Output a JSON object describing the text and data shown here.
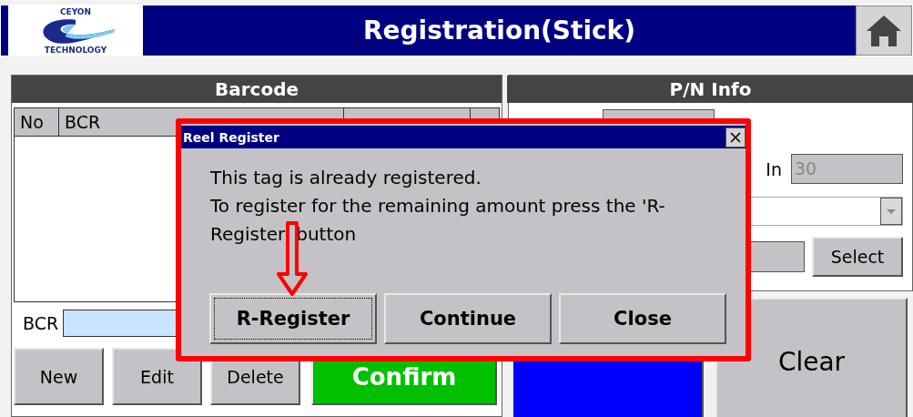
{
  "window": {
    "title": "Registration(Stick)",
    "logo_words": [
      "CEYON",
      "TECHNOLOGY"
    ]
  },
  "barcode_panel": {
    "title": "Barcode",
    "columns": [
      "No",
      "BCR"
    ],
    "bcr_label": "BCR",
    "buttons": [
      {
        "label": "New",
        "kind": "plain"
      },
      {
        "label": "Edit",
        "kind": "plain"
      },
      {
        "label": "Delete",
        "kind": "plain"
      },
      {
        "label": "Confirm",
        "kind": "confirm"
      }
    ]
  },
  "pn_info": {
    "title": "P/N Info",
    "in_label": "In",
    "in_value": "30",
    "select_button": "Select"
  },
  "actions": [
    {
      "kind": "complete"
    },
    {
      "label": "Clear",
      "kind": "plain"
    }
  ],
  "dialog": {
    "title": "Reel Register",
    "message": "This tag is already registered.\nTo register for the remaining amount press the 'R-Register' button",
    "buttons": [
      {
        "label": "R-Register",
        "focused": true
      },
      {
        "label": "Continue",
        "focused": false
      },
      {
        "label": "Close",
        "focused": false
      }
    ]
  }
}
